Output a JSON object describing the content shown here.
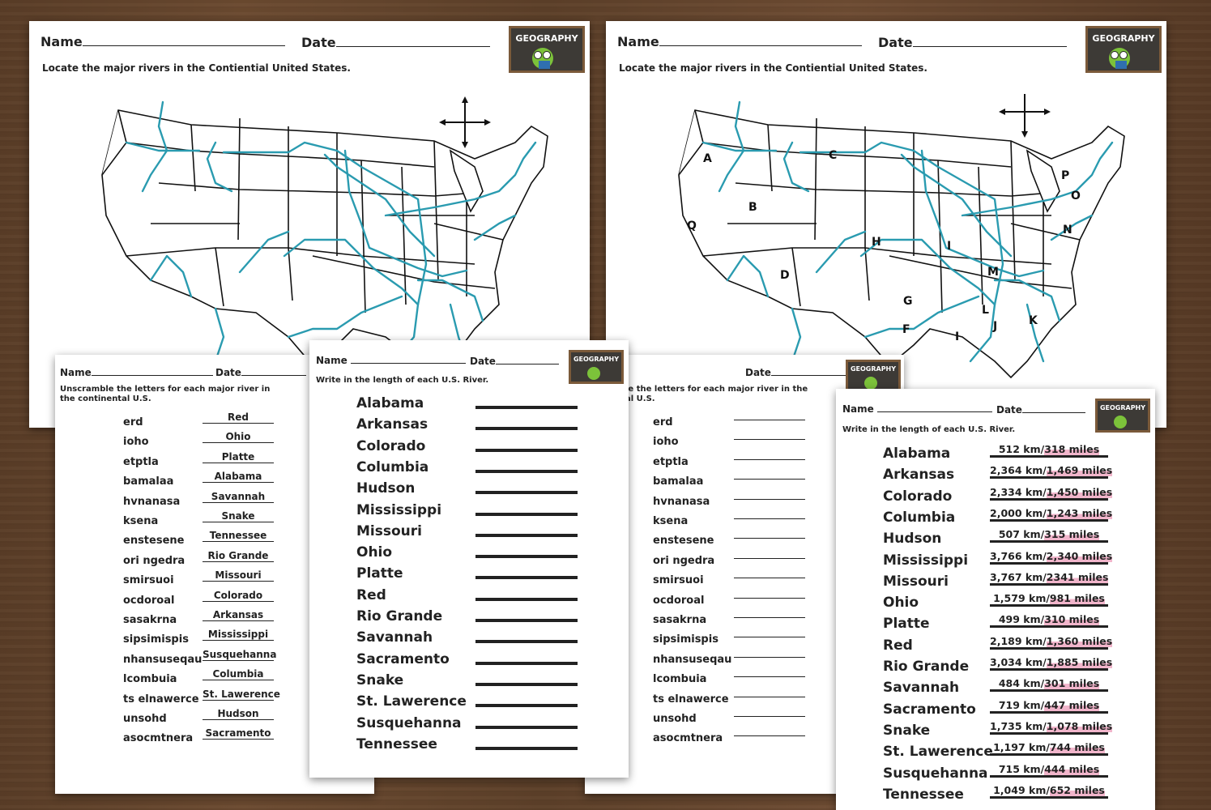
{
  "sheet_labels": {
    "name": "Name",
    "date": "Date",
    "badge": "GEOGRAPHY"
  },
  "map_sheet": {
    "instruction": "Locate the major rivers in the Contiential United States."
  },
  "map_letters": [
    "A",
    "B",
    "C",
    "D",
    "F",
    "G",
    "H",
    "I",
    "I",
    "J",
    "K",
    "L",
    "M",
    "N",
    "O",
    "P",
    "Q"
  ],
  "unscramble_sheet": {
    "instruction": "Unscramble the letters for each major river in the continental U.S.",
    "instruction_partial": "le the letters for each major river in the al U.S.",
    "items": [
      {
        "scrambled": "erd",
        "answer": "Red"
      },
      {
        "scrambled": "ioho",
        "answer": "Ohio"
      },
      {
        "scrambled": "etptla",
        "answer": "Platte"
      },
      {
        "scrambled": "bamalaa",
        "answer": "Alabama"
      },
      {
        "scrambled": "hvnanasa",
        "answer": "Savannah"
      },
      {
        "scrambled": "ksena",
        "answer": "Snake"
      },
      {
        "scrambled": "enstesene",
        "answer": "Tennessee"
      },
      {
        "scrambled": "ori ngedra",
        "answer": "Rio Grande"
      },
      {
        "scrambled": "smirsuoi",
        "answer": "Missouri"
      },
      {
        "scrambled": "ocdoroal",
        "answer": "Colorado"
      },
      {
        "scrambled": "sasakrna",
        "answer": "Arkansas"
      },
      {
        "scrambled": "sipsimispis",
        "answer": "Mississippi"
      },
      {
        "scrambled": "nhansuseqau",
        "answer": "Susquehanna"
      },
      {
        "scrambled": "lcombuia",
        "answer": "Columbia"
      },
      {
        "scrambled": "ts elnawerce",
        "answer": "St. Lawerence"
      },
      {
        "scrambled": "unsohd",
        "answer": "Hudson"
      },
      {
        "scrambled": "asocmtnera",
        "answer": "Sacramento"
      }
    ]
  },
  "length_sheet": {
    "instruction": "Write in the length of each U.S. River.",
    "rivers": [
      {
        "name": "Alabama",
        "length": "512 km/",
        "miles": "318 miles"
      },
      {
        "name": "Arkansas",
        "length": "2,364 km/",
        "miles": "1,469 miles"
      },
      {
        "name": "Colorado",
        "length": "2,334 km/",
        "miles": "1,450 miles"
      },
      {
        "name": "Columbia",
        "length": "2,000 km/",
        "miles": "1,243 miles"
      },
      {
        "name": "Hudson",
        "length": "507 km/",
        "miles": "315 miles"
      },
      {
        "name": "Mississippi",
        "length": "3,766 km/",
        "miles": "2,340 miles"
      },
      {
        "name": "Missouri",
        "length": "3,767 km/",
        "miles": "2341 miles"
      },
      {
        "name": "Ohio",
        "length": "1,579 km/",
        "miles": "981 miles"
      },
      {
        "name": "Platte",
        "length": "499 km/",
        "miles": "310 miles"
      },
      {
        "name": "Red",
        "length": "2,189 km/",
        "miles": "1,360 miles"
      },
      {
        "name": "Rio Grande",
        "length": "3,034 km/",
        "miles": "1,885 miles"
      },
      {
        "name": "Savannah",
        "length": "484 km/",
        "miles": "301 miles"
      },
      {
        "name": "Sacramento",
        "length": "719 km/",
        "miles": "447 miles"
      },
      {
        "name": "Snake",
        "length": "1,735 km/",
        "miles": "1,078 miles"
      },
      {
        "name": "St. Lawerence",
        "length": "1,197 km/",
        "miles": "744 miles"
      },
      {
        "name": "Susquehanna",
        "length": "715 km/",
        "miles": "444 miles"
      },
      {
        "name": "Tennessee",
        "length": "1,049 km/",
        "miles": "652 miles"
      }
    ]
  }
}
